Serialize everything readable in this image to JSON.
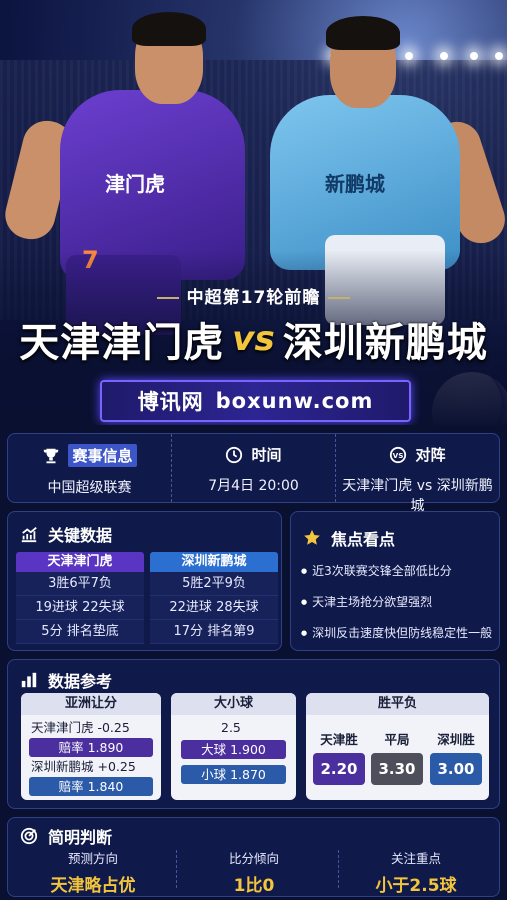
{
  "hero": {
    "subtitle": "中超第17轮前瞻",
    "home_team": "天津津门虎",
    "vs": "vs",
    "away_team": "深圳新鹏城",
    "site_name": "博讯网",
    "site_url": "boxunw.com",
    "home_jersey_text": "津门虎",
    "home_jersey_number": "7",
    "away_jersey_text": "新鹏城",
    "home_color": "#5a35c4",
    "away_color": "#6bb8e8"
  },
  "info": {
    "event_label": "赛事信息",
    "event_value": "中国超级联赛",
    "time_label": "时间",
    "time_value": "7月4日  20:00",
    "matchup_label": "对阵",
    "matchup_value": "天津津门虎 vs 深圳新鹏城"
  },
  "stats": {
    "title": "关键数据",
    "home": {
      "team": "天津津门虎",
      "rows": [
        "3胜6平7负",
        "19进球  22失球",
        "5分  排名垫底"
      ]
    },
    "away": {
      "team": "深圳新鹏城",
      "rows": [
        "5胜2平9负",
        "22进球  28失球",
        "17分  排名第9"
      ]
    }
  },
  "focus": {
    "title": "焦点看点",
    "items": [
      "近3次联赛交锋全部低比分",
      "天津主场抢分欲望强烈",
      "深圳反击速度快但防线稳定性一般"
    ]
  },
  "reference": {
    "title": "数据参考",
    "asian": {
      "title": "亚洲让分",
      "home_line": "天津津门虎  -0.25",
      "home_odds_label": "赔率",
      "home_odds": "1.890",
      "away_line": "深圳新鹏城  +0.25",
      "away_odds_label": "赔率",
      "away_odds": "1.840"
    },
    "totals": {
      "title": "大小球",
      "line": "2.5",
      "over_label": "大球",
      "over_odds": "1.900",
      "under_label": "小球",
      "under_odds": "1.870"
    },
    "result": {
      "title": "胜平负",
      "home_label": "天津胜",
      "home_odds": "2.20",
      "draw_label": "平局",
      "draw_odds": "3.30",
      "away_label": "深圳胜",
      "away_odds": "3.00"
    }
  },
  "judgement": {
    "title": "简明判断",
    "direction_label": "预测方向",
    "direction_value": "天津略占优",
    "score_label": "比分倾向",
    "score_value": "1比0",
    "focus_label": "关注重点",
    "focus_value": "小于2.5球"
  },
  "colors": {
    "accent_gold": "#f3c53c",
    "panel_bg": "#101a4a",
    "purple": "#4b2f9e",
    "blue": "#2b5aa8"
  }
}
